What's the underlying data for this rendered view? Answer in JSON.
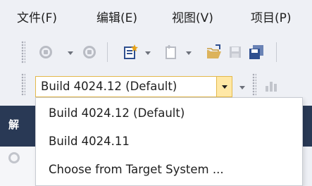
{
  "menu": {
    "items": [
      {
        "label": "文件(F)"
      },
      {
        "label": "编辑(E)"
      },
      {
        "label": "视图(V)"
      },
      {
        "label": "项目(P)"
      }
    ]
  },
  "toolbar": {
    "icons": [
      "back-icon",
      "forward-icon",
      "new-project-icon",
      "add-item-icon",
      "open-folder-icon",
      "save-icon",
      "save-all-icon"
    ]
  },
  "build_selector": {
    "selected": "Build 4024.12 (Default)",
    "options": [
      "Build 4024.12 (Default)",
      "Build 4024.11",
      "Choose from Target System ..."
    ]
  },
  "panel": {
    "header_glyph": "解"
  },
  "colors": {
    "background": "#eef0f5",
    "combo_border": "#e3b84a",
    "combo_button": "#ffe8a6",
    "panel_header": "#293955"
  }
}
